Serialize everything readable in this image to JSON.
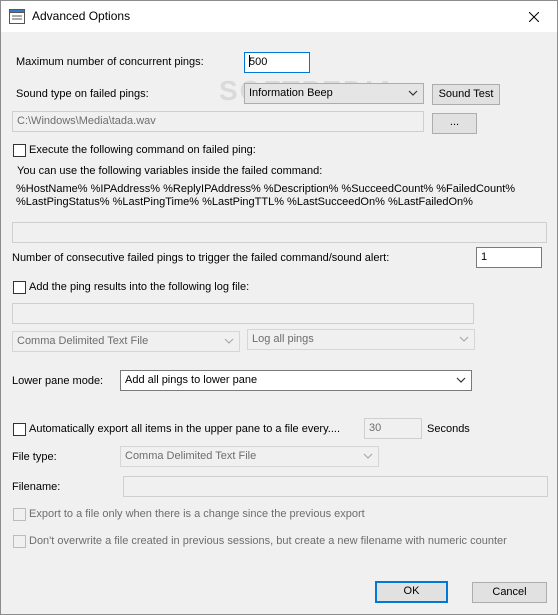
{
  "window": {
    "title": "Advanced Options",
    "icon": "app-options-icon",
    "close_glyph": "✕"
  },
  "pings": {
    "max_concurrent_label": "Maximum number of concurrent pings:",
    "max_concurrent_value": "500"
  },
  "sound": {
    "type_label": "Sound type on failed pings:",
    "type_value": "Information Beep",
    "test_button": "Sound Test",
    "file_path": "C:\\Windows\\Media\\tada.wav",
    "browse_button": "..."
  },
  "failed_command": {
    "checkbox_label": "Execute the following command on failed ping:",
    "checked": false,
    "hint": "You can use the following variables inside the failed command:",
    "variables_line1": "%HostName%  %IPAddress%  %ReplyIPAddress%  %Description%  %SucceedCount%  %FailedCount%",
    "variables_line2": "%LastPingStatus%  %LastPingTime%  %LastPingTTL%  %LastSucceedOn%  %LastFailedOn%",
    "command_value": ""
  },
  "consecutive": {
    "label": "Number of consecutive failed pings to trigger the failed command/sound alert:",
    "value": "1"
  },
  "log": {
    "checkbox_label": "Add the ping results into the following log file:",
    "checked": false,
    "file_value": "",
    "format_value": "Comma Delimited Text File",
    "mode_value": "Log all pings"
  },
  "lower_pane": {
    "label": "Lower pane mode:",
    "value": "Add all pings to lower pane"
  },
  "export": {
    "checkbox_label": "Automatically export all items in the upper pane to a file every....",
    "checked": false,
    "interval_value": "30",
    "interval_unit": "Seconds",
    "file_type_label": "File type:",
    "file_type_value": "Comma Delimited Text File",
    "filename_label": "Filename:",
    "filename_value": "",
    "only_on_change_label": "Export to a file only when there is a change since the previous export",
    "no_overwrite_label": "Don't overwrite a file created in previous sessions, but create a new filename with numeric counter"
  },
  "footer": {
    "ok": "OK",
    "cancel": "Cancel"
  },
  "watermark": "SOFTPEDIA",
  "colors": {
    "accent": "#0078d7",
    "dialog_bg": "#f0f0f0",
    "disabled_text": "#6d6d6d"
  }
}
